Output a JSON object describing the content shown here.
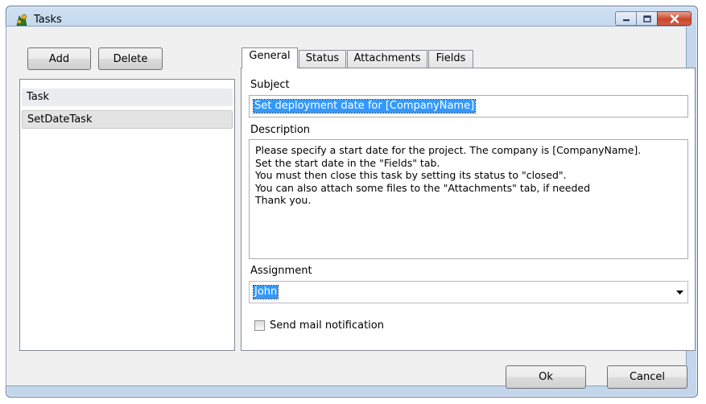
{
  "window": {
    "title": "Tasks",
    "app_icon": "app-icon"
  },
  "left": {
    "add_label": "Add",
    "delete_label": "Delete",
    "items": [
      {
        "label": "Task"
      },
      {
        "label": "SetDateTask"
      }
    ]
  },
  "tabs": [
    {
      "label": "General"
    },
    {
      "label": "Status"
    },
    {
      "label": "Attachments"
    },
    {
      "label": "Fields"
    }
  ],
  "general": {
    "subject_label": "Subject",
    "subject_value": "Set deployment date for [CompanyName]",
    "description_label": "Description",
    "description_value": "Please specify a start date for the project. The company is [CompanyName].\nSet the start date in the \"Fields\" tab.\nYou must then close this task by setting its status to \"closed\".\nYou can also attach some files to the \"Attachments\" tab, if needed\nThank you.",
    "assignment_label": "Assignment",
    "assignment_value": "John",
    "mail_label": "Send mail notification",
    "mail_checked": false
  },
  "footer": {
    "ok_label": "Ok",
    "cancel_label": "Cancel"
  },
  "colors": {
    "selection": "#3399ff",
    "titlebar": "#c3d6ec",
    "close": "#c9462c"
  }
}
